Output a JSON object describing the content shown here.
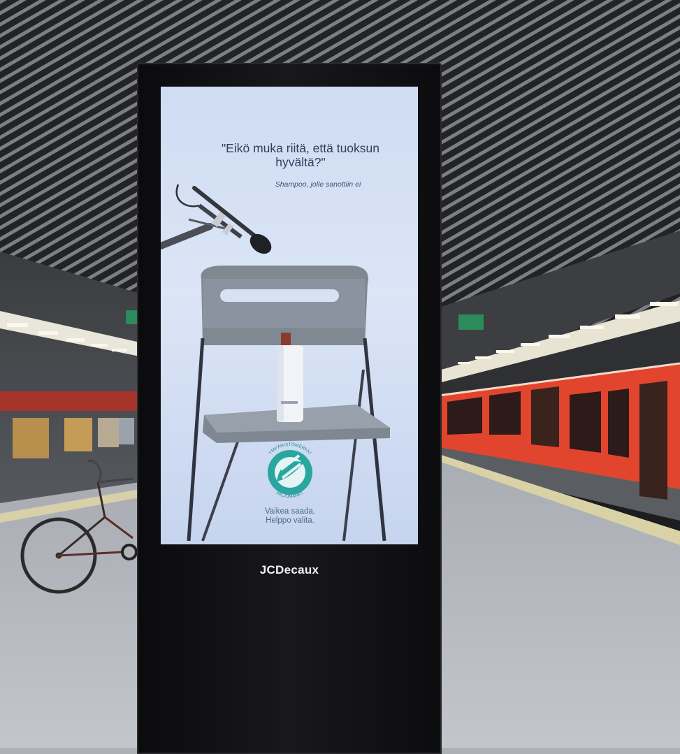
{
  "ad": {
    "quote": "\"Eikö muka riitä, että tuoksun hyvältä?\"",
    "attribution": "Shampoo, jolle sanottiin ei",
    "tagline_line1": "Vaikea saada.",
    "tagline_line2": "Helppo valita.",
    "ecolabel_top_text": "YMPÄRISTÖMERKKI",
    "ecolabel_bottom_text": "MILJÖMÄRKT"
  },
  "kiosk": {
    "brand": "JCDecaux"
  },
  "colors": {
    "train": "#e2452e",
    "ad_background": "#d6e1f4",
    "ecolabel": "#2aa6a0"
  }
}
